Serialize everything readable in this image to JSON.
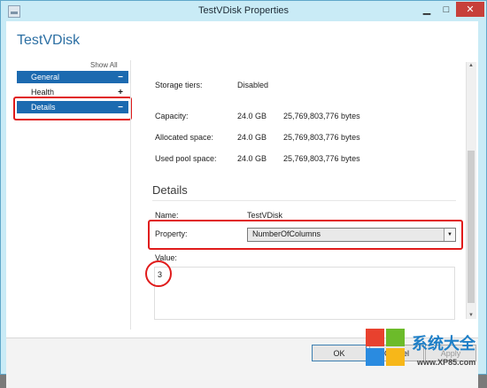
{
  "window": {
    "title": "TestVDisk Properties"
  },
  "titlebar": {
    "minimize": "▁",
    "maximize": "□",
    "close": "✕"
  },
  "dialog": {
    "heading": "TestVDisk"
  },
  "sidebar": {
    "show_all": "Show All",
    "items": [
      {
        "label": "General",
        "sign": "−",
        "selected": true
      },
      {
        "label": "Health",
        "sign": "+",
        "selected": false
      },
      {
        "label": "Details",
        "sign": "−",
        "selected": true
      }
    ]
  },
  "properties": {
    "storage_tiers": {
      "label": "Storage tiers:",
      "value": "Disabled"
    },
    "capacity": {
      "label": "Capacity:",
      "gb": "24.0 GB",
      "bytes": "25,769,803,776 bytes"
    },
    "allocated": {
      "label": "Allocated space:",
      "gb": "24.0 GB",
      "bytes": "25,769,803,776 bytes"
    },
    "used_pool": {
      "label": "Used pool space:",
      "gb": "24.0 GB",
      "bytes": "25,769,803,776 bytes"
    }
  },
  "details": {
    "heading": "Details",
    "name_label": "Name:",
    "name_value": "TestVDisk",
    "property_label": "Property:",
    "property_value": "NumberOfColumns",
    "value_label": "Value:",
    "value": "3"
  },
  "buttons": {
    "ok": "OK",
    "cancel": "Cancel",
    "apply": "Apply"
  },
  "watermark": {
    "text": "系统大全",
    "url": "www.XP85.com"
  },
  "colors": {
    "selected": "#1c6ab0",
    "highlight": "#e01b1b",
    "title_bar": "#c9ebf6",
    "heading": "#2c6fa3"
  },
  "icons": {
    "dropdown": "chevron-down-icon",
    "window": "app-window-icon",
    "scroll_up": "scroll-up-icon",
    "scroll_down": "scroll-down-icon"
  }
}
